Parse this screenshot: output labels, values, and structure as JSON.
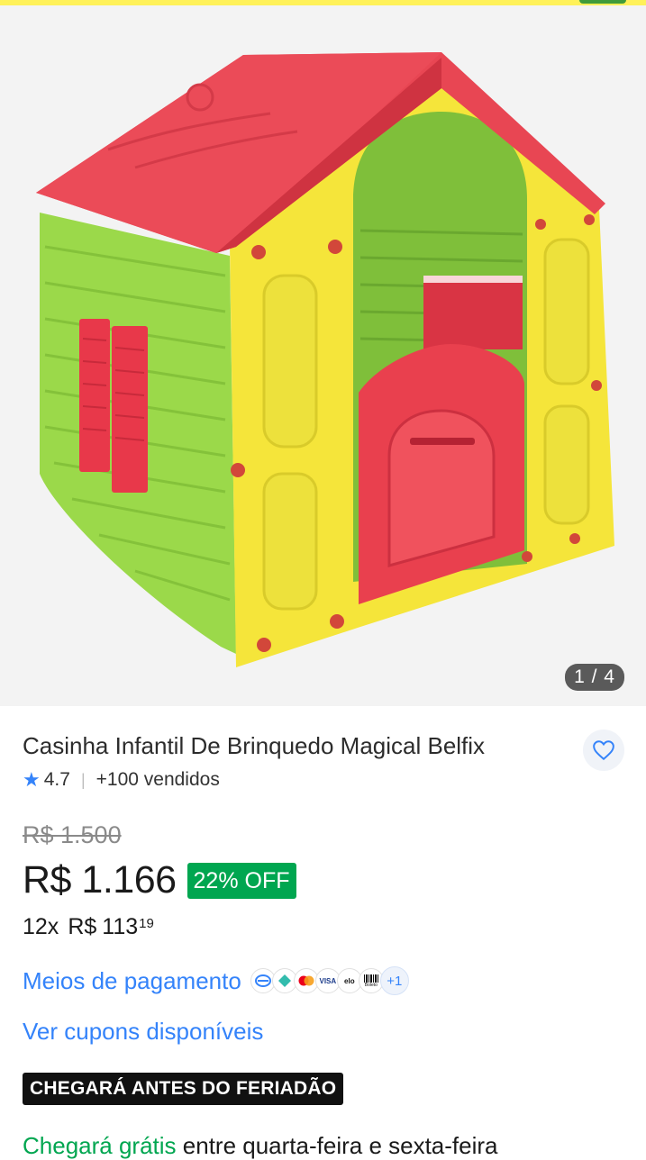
{
  "gallery": {
    "counter": "1 / 4",
    "image_alt": "casinha infantil colorida"
  },
  "product": {
    "title": "Casinha Infantil De Brinquedo Magical Belfix",
    "rating": "4.7",
    "sold": "+100 vendidos",
    "old_price": "R$ 1.500",
    "price": "R$ 1.166",
    "discount": "22% OFF",
    "installments_count": "12x",
    "installment_currency": "R$",
    "installment_value": "113",
    "installment_cents": "19"
  },
  "payment": {
    "link": "Meios de pagamento",
    "icons": [
      "pix",
      "bank-slip",
      "mastercard",
      "visa",
      "elo",
      "boleto"
    ],
    "icon_labels": {
      "visa": "VISA",
      "elo": "elo",
      "boleto": "Boleto"
    },
    "more": "+1"
  },
  "coupons": {
    "link": "Ver cupons disponíveis"
  },
  "shipping": {
    "badge": "CHEGARÁ ANTES DO FERIADÃO",
    "free_label": "Chegará grátis",
    "window": " entre quarta-feira e sexta-feira"
  },
  "colors": {
    "accent": "#3483fa",
    "green": "#00a650",
    "header": "#fff159"
  }
}
